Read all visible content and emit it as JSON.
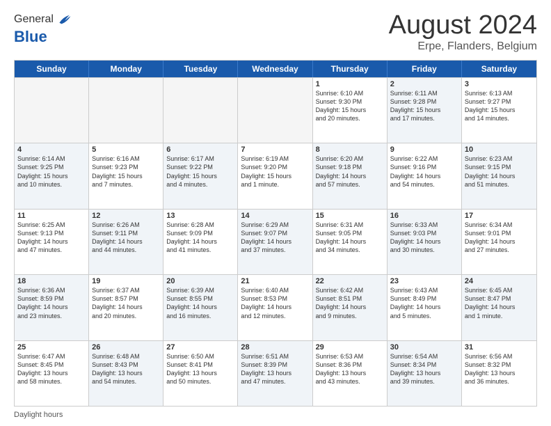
{
  "header": {
    "logo_line1": "General",
    "logo_line2": "Blue",
    "main_title": "August 2024",
    "subtitle": "Erpe, Flanders, Belgium"
  },
  "calendar": {
    "days_of_week": [
      "Sunday",
      "Monday",
      "Tuesday",
      "Wednesday",
      "Thursday",
      "Friday",
      "Saturday"
    ],
    "rows": [
      [
        {
          "num": "",
          "info": "",
          "empty": true
        },
        {
          "num": "",
          "info": "",
          "empty": true
        },
        {
          "num": "",
          "info": "",
          "empty": true
        },
        {
          "num": "",
          "info": "",
          "empty": true
        },
        {
          "num": "1",
          "info": "Sunrise: 6:10 AM\nSunset: 9:30 PM\nDaylight: 15 hours\nand 20 minutes.",
          "shaded": false
        },
        {
          "num": "2",
          "info": "Sunrise: 6:11 AM\nSunset: 9:28 PM\nDaylight: 15 hours\nand 17 minutes.",
          "shaded": true
        },
        {
          "num": "3",
          "info": "Sunrise: 6:13 AM\nSunset: 9:27 PM\nDaylight: 15 hours\nand 14 minutes.",
          "shaded": false
        }
      ],
      [
        {
          "num": "4",
          "info": "Sunrise: 6:14 AM\nSunset: 9:25 PM\nDaylight: 15 hours\nand 10 minutes.",
          "shaded": true
        },
        {
          "num": "5",
          "info": "Sunrise: 6:16 AM\nSunset: 9:23 PM\nDaylight: 15 hours\nand 7 minutes.",
          "shaded": false
        },
        {
          "num": "6",
          "info": "Sunrise: 6:17 AM\nSunset: 9:22 PM\nDaylight: 15 hours\nand 4 minutes.",
          "shaded": true
        },
        {
          "num": "7",
          "info": "Sunrise: 6:19 AM\nSunset: 9:20 PM\nDaylight: 15 hours\nand 1 minute.",
          "shaded": false
        },
        {
          "num": "8",
          "info": "Sunrise: 6:20 AM\nSunset: 9:18 PM\nDaylight: 14 hours\nand 57 minutes.",
          "shaded": true
        },
        {
          "num": "9",
          "info": "Sunrise: 6:22 AM\nSunset: 9:16 PM\nDaylight: 14 hours\nand 54 minutes.",
          "shaded": false
        },
        {
          "num": "10",
          "info": "Sunrise: 6:23 AM\nSunset: 9:15 PM\nDaylight: 14 hours\nand 51 minutes.",
          "shaded": true
        }
      ],
      [
        {
          "num": "11",
          "info": "Sunrise: 6:25 AM\nSunset: 9:13 PM\nDaylight: 14 hours\nand 47 minutes.",
          "shaded": false
        },
        {
          "num": "12",
          "info": "Sunrise: 6:26 AM\nSunset: 9:11 PM\nDaylight: 14 hours\nand 44 minutes.",
          "shaded": true
        },
        {
          "num": "13",
          "info": "Sunrise: 6:28 AM\nSunset: 9:09 PM\nDaylight: 14 hours\nand 41 minutes.",
          "shaded": false
        },
        {
          "num": "14",
          "info": "Sunrise: 6:29 AM\nSunset: 9:07 PM\nDaylight: 14 hours\nand 37 minutes.",
          "shaded": true
        },
        {
          "num": "15",
          "info": "Sunrise: 6:31 AM\nSunset: 9:05 PM\nDaylight: 14 hours\nand 34 minutes.",
          "shaded": false
        },
        {
          "num": "16",
          "info": "Sunrise: 6:33 AM\nSunset: 9:03 PM\nDaylight: 14 hours\nand 30 minutes.",
          "shaded": true
        },
        {
          "num": "17",
          "info": "Sunrise: 6:34 AM\nSunset: 9:01 PM\nDaylight: 14 hours\nand 27 minutes.",
          "shaded": false
        }
      ],
      [
        {
          "num": "18",
          "info": "Sunrise: 6:36 AM\nSunset: 8:59 PM\nDaylight: 14 hours\nand 23 minutes.",
          "shaded": true
        },
        {
          "num": "19",
          "info": "Sunrise: 6:37 AM\nSunset: 8:57 PM\nDaylight: 14 hours\nand 20 minutes.",
          "shaded": false
        },
        {
          "num": "20",
          "info": "Sunrise: 6:39 AM\nSunset: 8:55 PM\nDaylight: 14 hours\nand 16 minutes.",
          "shaded": true
        },
        {
          "num": "21",
          "info": "Sunrise: 6:40 AM\nSunset: 8:53 PM\nDaylight: 14 hours\nand 12 minutes.",
          "shaded": false
        },
        {
          "num": "22",
          "info": "Sunrise: 6:42 AM\nSunset: 8:51 PM\nDaylight: 14 hours\nand 9 minutes.",
          "shaded": true
        },
        {
          "num": "23",
          "info": "Sunrise: 6:43 AM\nSunset: 8:49 PM\nDaylight: 14 hours\nand 5 minutes.",
          "shaded": false
        },
        {
          "num": "24",
          "info": "Sunrise: 6:45 AM\nSunset: 8:47 PM\nDaylight: 14 hours\nand 1 minute.",
          "shaded": true
        }
      ],
      [
        {
          "num": "25",
          "info": "Sunrise: 6:47 AM\nSunset: 8:45 PM\nDaylight: 13 hours\nand 58 minutes.",
          "shaded": false
        },
        {
          "num": "26",
          "info": "Sunrise: 6:48 AM\nSunset: 8:43 PM\nDaylight: 13 hours\nand 54 minutes.",
          "shaded": true
        },
        {
          "num": "27",
          "info": "Sunrise: 6:50 AM\nSunset: 8:41 PM\nDaylight: 13 hours\nand 50 minutes.",
          "shaded": false
        },
        {
          "num": "28",
          "info": "Sunrise: 6:51 AM\nSunset: 8:39 PM\nDaylight: 13 hours\nand 47 minutes.",
          "shaded": true
        },
        {
          "num": "29",
          "info": "Sunrise: 6:53 AM\nSunset: 8:36 PM\nDaylight: 13 hours\nand 43 minutes.",
          "shaded": false
        },
        {
          "num": "30",
          "info": "Sunrise: 6:54 AM\nSunset: 8:34 PM\nDaylight: 13 hours\nand 39 minutes.",
          "shaded": true
        },
        {
          "num": "31",
          "info": "Sunrise: 6:56 AM\nSunset: 8:32 PM\nDaylight: 13 hours\nand 36 minutes.",
          "shaded": false
        }
      ]
    ]
  },
  "footer": {
    "label": "Daylight hours"
  }
}
